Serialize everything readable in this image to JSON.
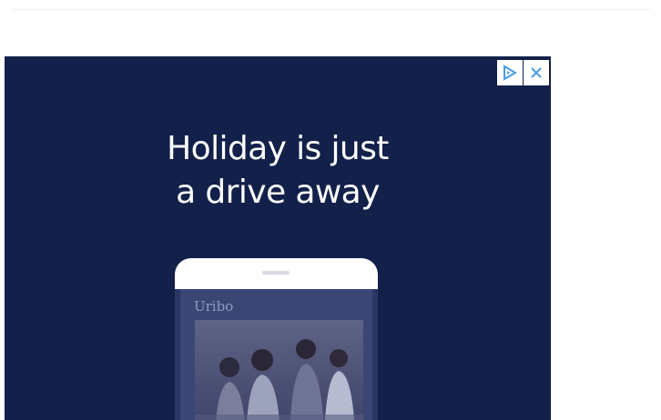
{
  "ad": {
    "headline_line1": "Holiday is just",
    "headline_line2": "a drive away",
    "app_brand": "Uribo",
    "ad_choices_icon": "adchoices-play-icon",
    "close_icon": "close-x-icon",
    "colors": {
      "background": "#12204a",
      "text": "#ffffff",
      "accent": "#4a9be6"
    }
  }
}
